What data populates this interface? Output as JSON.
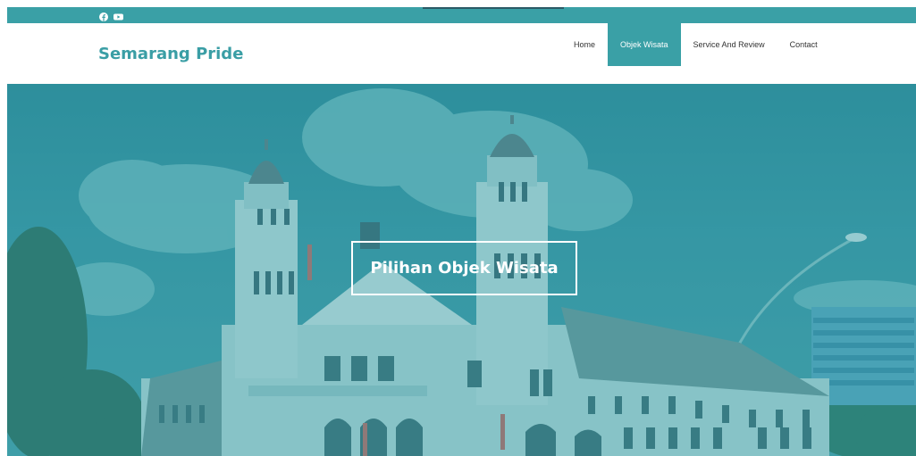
{
  "topbar": {
    "social_icons": [
      "facebook-icon",
      "youtube-icon"
    ]
  },
  "header": {
    "brand": "Semarang Pride"
  },
  "nav": {
    "items": [
      {
        "label": "Home",
        "active": false
      },
      {
        "label": "Objek Wisata",
        "active": true
      },
      {
        "label": "Service And Review",
        "active": false
      },
      {
        "label": "Contact",
        "active": false
      }
    ]
  },
  "hero": {
    "title": "Pilihan Objek Wisata"
  },
  "colors": {
    "accent": "#3aa0a6",
    "brand_text": "#3a9ea5",
    "hero_tint": "#2f8c9a"
  }
}
